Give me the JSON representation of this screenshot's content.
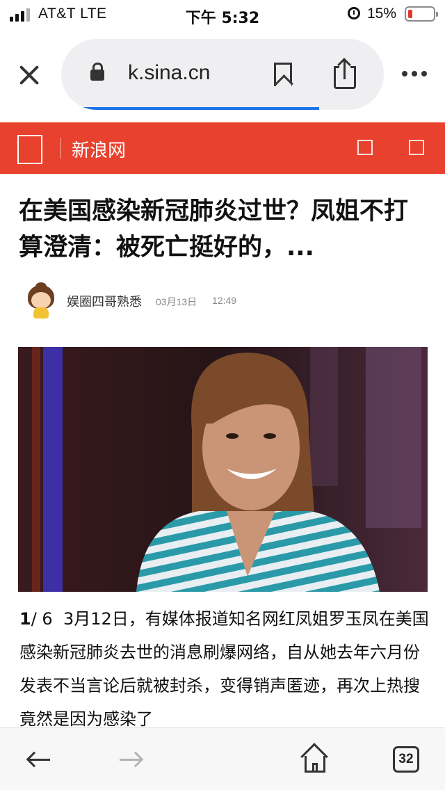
{
  "status_bar": {
    "carrier": "AT&T   LTE",
    "time": "下午 5:32",
    "battery_percent": "15%",
    "battery_level": 0.15
  },
  "browser": {
    "url": "k.sina.cn",
    "load_progress": 0.8,
    "tab_count": "32"
  },
  "site_header": {
    "title": "新浪网"
  },
  "article": {
    "headline": "在美国感染新冠肺炎过世？凤姐不打算澄清：被死亡挺好的，...",
    "author": "娱圈四哥熟悉",
    "date": "03月13日",
    "time": "12:49",
    "image_counter_current": "1",
    "image_counter_total": "/ 6",
    "body": "3月12日，有媒体报道知名网红凤姐罗玉凤在美国感染新冠肺炎去世的消息刷爆网络，自从她去年六月份发表不当言论后就被封杀，变得销声匿迹，再次上热搜竟然是因为感染了"
  },
  "colors": {
    "sina_red": "#e8412e",
    "progress_blue": "#1a73e8",
    "battery_low": "#e5342d"
  },
  "icons": [
    "signal-icon",
    "alarm-icon",
    "battery-icon",
    "close-icon",
    "lock-icon",
    "bookmark-icon",
    "share-icon",
    "more-icon",
    "back-arrow-icon",
    "forward-arrow-icon",
    "home-icon",
    "tabs-icon"
  ]
}
